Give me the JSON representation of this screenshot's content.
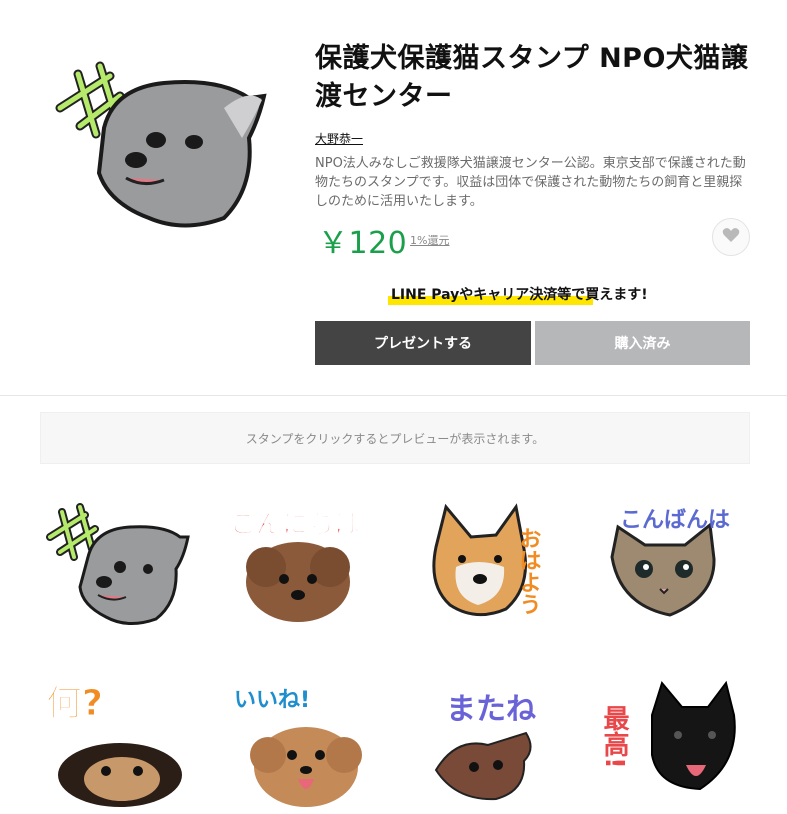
{
  "product": {
    "title": "保護犬保護猫スタンプ NPO犬猫譲渡センター",
    "author": "大野恭一",
    "description": "NPO法人みなしご救援隊犬猫譲渡センター公認。東京支部で保護された動物たちのスタンプです。収益は団体で保護された動物たちの飼育と里親探しのために活用いたします。",
    "price": "￥120",
    "cashback": "1%還元"
  },
  "purchase": {
    "pay_notice": "LINE Payやキャリア決済等で買えます!",
    "gift_label": "プレゼントする",
    "purchased_label": "購入済み"
  },
  "preview_notice": "スタンプをクリックするとプレビューが表示されます。",
  "stickers": [
    {
      "caption": "キキ"
    },
    {
      "caption": "こんにちは"
    },
    {
      "caption": "おはよう"
    },
    {
      "caption": "こんばんは"
    },
    {
      "caption": "何?"
    },
    {
      "caption": "いいね!"
    },
    {
      "caption": "またね"
    },
    {
      "caption": "最高!"
    }
  ],
  "colors": {
    "price": "#1aa04a",
    "highlight": "#ffe600",
    "gift_button": "#444444",
    "purchased_button": "#b6b7b9"
  }
}
